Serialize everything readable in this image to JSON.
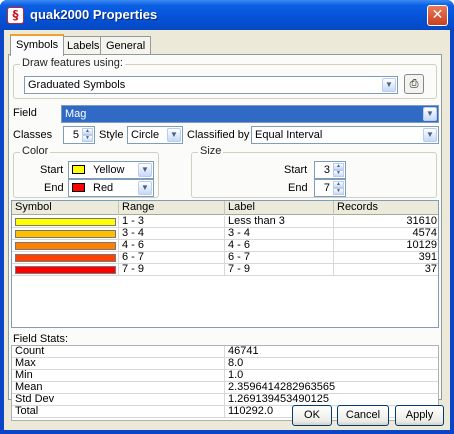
{
  "window": {
    "title": "quak2000 Properties",
    "app_icon_glyph": "§",
    "close_glyph": "✕"
  },
  "tabs": [
    {
      "label": "Symbols",
      "active": true
    },
    {
      "label": "Labels",
      "active": false
    },
    {
      "label": "General",
      "active": false
    }
  ],
  "draw": {
    "group_label": "Draw features using:",
    "value": "Graduated Symbols"
  },
  "field": {
    "label": "Field",
    "value": "Mag"
  },
  "classes": {
    "label": "Classes",
    "value": "5",
    "style_label": "Style",
    "style_value": "Circle",
    "classified_label": "Classified by",
    "classified_value": "Equal Interval"
  },
  "color": {
    "group_label": "Color",
    "start_label": "Start",
    "start_value": "Yellow",
    "start_color": "#ffff00",
    "end_label": "End",
    "end_value": "Red",
    "end_color": "#ff0000"
  },
  "size": {
    "group_label": "Size",
    "start_label": "Start",
    "start_value": "3",
    "end_label": "End",
    "end_value": "7"
  },
  "classes_table": {
    "headers": [
      "Symbol",
      "Range",
      "Label",
      "Records"
    ],
    "rows": [
      {
        "color": "#ffff00",
        "range": "1 - 3",
        "label": "Less than 3",
        "records": "31610"
      },
      {
        "color": "#ffbf00",
        "range": "3 - 4",
        "label": "3 - 4",
        "records": "4574"
      },
      {
        "color": "#ff7f00",
        "range": "4 - 6",
        "label": "4 - 6",
        "records": "10129"
      },
      {
        "color": "#ff4000",
        "range": "6 - 7",
        "label": "6 - 7",
        "records": "391"
      },
      {
        "color": "#ff0000",
        "range": "7 - 9",
        "label": "7 - 9",
        "records": "37"
      }
    ]
  },
  "stats": {
    "title": "Field Stats:",
    "rows": [
      {
        "name": "Count",
        "value": "46741"
      },
      {
        "name": "Max",
        "value": "8.0"
      },
      {
        "name": "Min",
        "value": "1.0"
      },
      {
        "name": "Mean",
        "value": "2.3596414282963565"
      },
      {
        "name": "Std Dev",
        "value": "1.269139453490125"
      },
      {
        "name": "Total",
        "value": "110292.0"
      }
    ]
  },
  "buttons": {
    "ok": "OK",
    "cancel": "Cancel",
    "apply": "Apply"
  },
  "icons": {
    "dropdown": "▼",
    "spin_up": "▲",
    "spin_down": "▼",
    "symbol_picker": "⎙"
  }
}
